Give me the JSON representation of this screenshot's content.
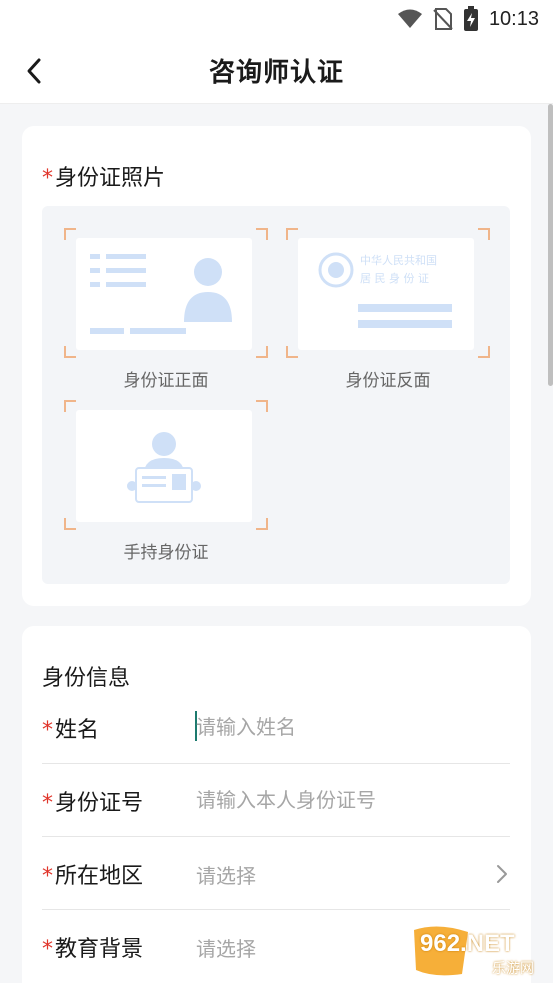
{
  "status_bar": {
    "time": "10:13",
    "icons": [
      "wifi-icon",
      "no-sim-icon",
      "battery-charging-icon"
    ]
  },
  "header": {
    "title": "咨询师认证",
    "back_icon": "chevron-left-icon"
  },
  "photos_section": {
    "required_mark": "*",
    "title": "身份证照片",
    "slots": [
      {
        "label": "身份证正面",
        "illustration": "id-card-front-icon"
      },
      {
        "label": "身份证反面",
        "illustration": "id-card-back-icon",
        "emblem_text": [
          "中华人民共和国",
          "居 民 身 份 证"
        ]
      },
      {
        "label": "手持身份证",
        "illustration": "hand-held-id-icon"
      }
    ]
  },
  "info_section": {
    "title": "身份信息",
    "fields": [
      {
        "required_mark": "*",
        "label": "姓名",
        "placeholder": "请输入姓名",
        "type": "text"
      },
      {
        "required_mark": "*",
        "label": "身份证号",
        "placeholder": "请输入本人身份证号",
        "type": "text"
      },
      {
        "required_mark": "*",
        "label": "所在地区",
        "value": "请选择",
        "type": "select"
      },
      {
        "required_mark": "*",
        "label": "教育背景",
        "value": "请选择",
        "type": "select"
      }
    ]
  },
  "watermark": {
    "main": "962.NET",
    "sub": "乐游网"
  },
  "colors": {
    "required": "#e0352b",
    "accent_caret": "#1c7a6e",
    "corner_marks": "#f0b58a",
    "illustration": "#cfe0f7",
    "background": "#f5f6f8"
  }
}
